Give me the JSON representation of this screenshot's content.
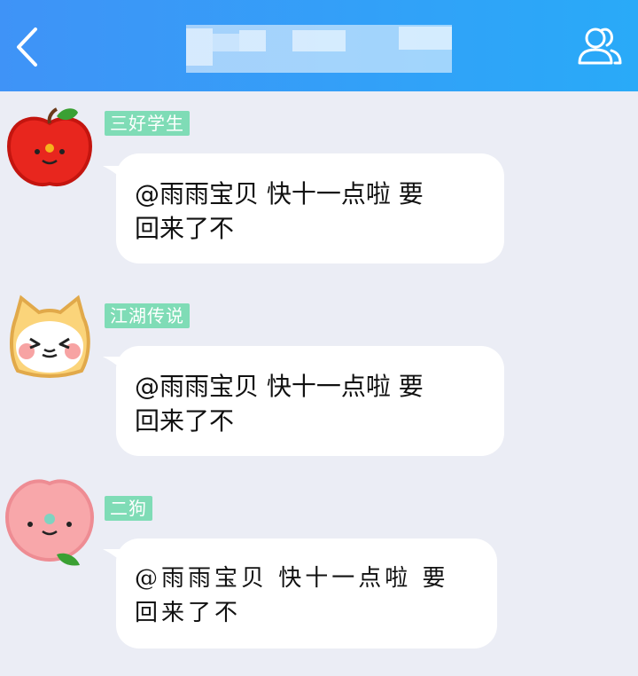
{
  "header": {
    "title": "",
    "back_icon": "chevron-left-icon",
    "group_icon": "group-members-icon"
  },
  "colors": {
    "header_start": "#3f93f7",
    "header_end": "#29aaf8",
    "name_tag": "#7fdcb6",
    "background": "#ebedf5"
  },
  "messages": [
    {
      "sender": "三好学生",
      "avatar": "apple-avatar",
      "text": "@雨雨宝贝 快十一点啦 要\n回来了不"
    },
    {
      "sender": "江湖传说",
      "avatar": "cat-avatar",
      "text": "@雨雨宝贝 快十一点啦 要\n回来了不"
    },
    {
      "sender": "二狗",
      "avatar": "peach-avatar",
      "text": "@雨雨宝贝 快十一点啦  要\n回来了不"
    }
  ]
}
